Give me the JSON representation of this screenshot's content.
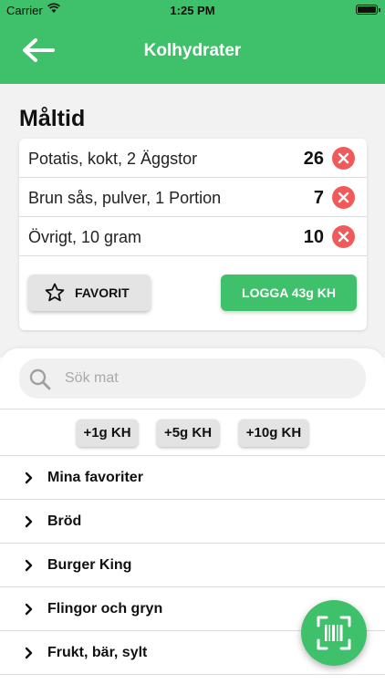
{
  "status_bar": {
    "carrier": "Carrier",
    "time": "1:25 PM"
  },
  "navbar": {
    "title": "Kolhydrater",
    "back_icon": "arrow-left-icon"
  },
  "meal": {
    "heading": "Måltid",
    "items": [
      {
        "name": "Potatis, kokt, 2 Äggstor",
        "value": "26"
      },
      {
        "name": "Brun sås, pulver, 1 Portion",
        "value": "7"
      },
      {
        "name": "Övrigt, 10 gram",
        "value": "10"
      }
    ],
    "favorite_label": "FAVORIT",
    "log_label": "LOGGA 43g KH"
  },
  "search": {
    "placeholder": "Sök mat",
    "value": ""
  },
  "quick_add": [
    "+1g KH",
    "+5g KH",
    "+10g KH"
  ],
  "categories": [
    "Mina favoriter",
    "Bröd",
    "Burger King",
    "Flingor och gryn",
    "Frukt, bär, sylt"
  ],
  "colors": {
    "accent": "#3fc06a",
    "remove": "#f15a5a",
    "background": "#f2f2f2"
  },
  "icons": {
    "remove": "close-icon",
    "favorite": "star-icon",
    "search": "search-icon",
    "category": "chevron-right-icon",
    "scan": "barcode-scan-icon"
  }
}
